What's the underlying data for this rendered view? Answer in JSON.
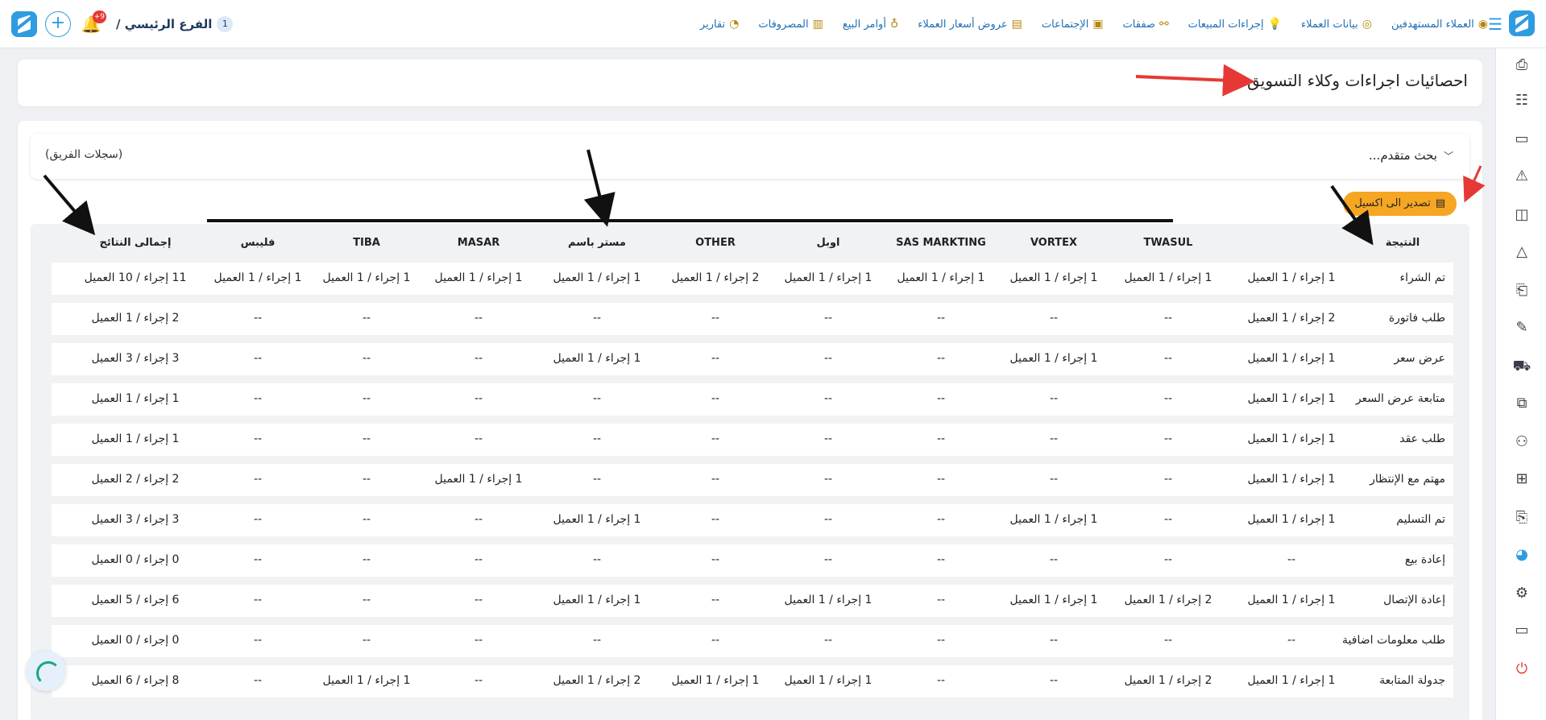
{
  "topbar": {
    "branch_label": "الفرع الرئيسي /",
    "branch_number": "1",
    "notification_count": "+9",
    "nav_items": [
      {
        "label": "العملاء المستهدفين",
        "icon": "target-users-icon"
      },
      {
        "label": "بيانات العملاء",
        "icon": "customer-data-icon"
      },
      {
        "label": "إجراءات المبيعات",
        "icon": "sales-actions-icon"
      },
      {
        "label": "صفقات",
        "icon": "deals-icon"
      },
      {
        "label": "الإجتماعات",
        "icon": "meetings-icon"
      },
      {
        "label": "عروض أسعار العملاء",
        "icon": "quotes-icon"
      },
      {
        "label": "أوامر البيع",
        "icon": "sales-orders-icon"
      },
      {
        "label": "المصروفات",
        "icon": "expenses-icon"
      },
      {
        "label": "تقارير",
        "icon": "reports-icon"
      }
    ]
  },
  "page": {
    "title": "احصائيات اجراءات وكلاء التسويق"
  },
  "search": {
    "advanced_label": "بحث متقدم...",
    "team_records": "(سجلات الفريق)"
  },
  "export": {
    "label": "تصدير الى اكسيل"
  },
  "table": {
    "headers": [
      "النتيجة",
      "",
      "TWASUL",
      "VORTEX",
      "SAS MARKTING",
      "اوبل",
      "OTHER",
      "مستر باسم",
      "MASAR",
      "TIBA",
      "فليبس",
      "إجمالى النتائج"
    ],
    "rows": [
      {
        "result": "تم الشراء",
        "cells": [
          "1 إجراء / 1 العميل",
          "1 إجراء / 1 العميل",
          "1 إجراء / 1 العميل",
          "1 إجراء / 1 العميل",
          "1 إجراء / 1 العميل",
          "2 إجراء / 1 العميل",
          "1 إجراء / 1 العميل",
          "1 إجراء / 1 العميل",
          "1 إجراء / 1 العميل",
          "1 إجراء / 1 العميل",
          "11 إجراء / 10 العميل"
        ]
      },
      {
        "result": "طلب فاتورة",
        "cells": [
          "2 إجراء / 1 العميل",
          "--",
          "--",
          "--",
          "--",
          "--",
          "--",
          "--",
          "--",
          "--",
          "2 إجراء / 1 العميل"
        ]
      },
      {
        "result": "عرض سعر",
        "cells": [
          "1 إجراء / 1 العميل",
          "--",
          "1 إجراء / 1 العميل",
          "--",
          "--",
          "--",
          "1 إجراء / 1 العميل",
          "--",
          "--",
          "--",
          "3 إجراء / 3 العميل"
        ]
      },
      {
        "result": "متابعة عرض السعر",
        "cells": [
          "1 إجراء / 1 العميل",
          "--",
          "--",
          "--",
          "--",
          "--",
          "--",
          "--",
          "--",
          "--",
          "1 إجراء / 1 العميل"
        ]
      },
      {
        "result": "طلب عقد",
        "cells": [
          "1 إجراء / 1 العميل",
          "--",
          "--",
          "--",
          "--",
          "--",
          "--",
          "--",
          "--",
          "--",
          "1 إجراء / 1 العميل"
        ]
      },
      {
        "result": "مهتم مع الإنتظار",
        "cells": [
          "1 إجراء / 1 العميل",
          "--",
          "--",
          "--",
          "--",
          "--",
          "--",
          "1 إجراء / 1 العميل",
          "--",
          "--",
          "2 إجراء / 2 العميل"
        ]
      },
      {
        "result": "تم التسليم",
        "cells": [
          "1 إجراء / 1 العميل",
          "--",
          "1 إجراء / 1 العميل",
          "--",
          "--",
          "--",
          "1 إجراء / 1 العميل",
          "--",
          "--",
          "--",
          "3 إجراء / 3 العميل"
        ]
      },
      {
        "result": "إعادة بيع",
        "cells": [
          "--",
          "--",
          "--",
          "--",
          "--",
          "--",
          "--",
          "--",
          "--",
          "--",
          "0 إجراء / 0 العميل"
        ]
      },
      {
        "result": "إعادة الإتصال",
        "cells": [
          "1 إجراء / 1 العميل",
          "2 إجراء / 1 العميل",
          "1 إجراء / 1 العميل",
          "--",
          "1 إجراء / 1 العميل",
          "--",
          "1 إجراء / 1 العميل",
          "--",
          "--",
          "--",
          "6 إجراء / 5 العميل"
        ]
      },
      {
        "result": "طلب معلومات اضافية",
        "cells": [
          "--",
          "--",
          "--",
          "--",
          "--",
          "--",
          "--",
          "--",
          "--",
          "--",
          "0 إجراء / 0 العميل"
        ]
      },
      {
        "result": "جدولة المتابعة",
        "cells": [
          "1 إجراء / 1 العميل",
          "2 إجراء / 1 العميل",
          "--",
          "--",
          "1 إجراء / 1 العميل",
          "1 إجراء / 1 العميل",
          "2 إجراء / 1 العميل",
          "--",
          "1 إجراء / 1 العميل",
          "--",
          "8 إجراء / 6 العميل"
        ]
      }
    ]
  },
  "sidebar": {
    "icons": [
      "add-file-icon",
      "team-icon",
      "cash-icon",
      "warning-icon",
      "video-icon",
      "chart-triangle-icon",
      "invoice-icon",
      "sign-pen-icon",
      "delivery-icon",
      "boxes-icon",
      "user-settings-icon",
      "add-document-icon",
      "clipboard-icon",
      "analytics-icon",
      "settings-icon",
      "screen-icon",
      "power-icon"
    ]
  },
  "colors": {
    "accent": "#2f9be0",
    "export_button": "#f5a623",
    "annotation_red": "#e53935",
    "annotation_black": "#111111"
  }
}
